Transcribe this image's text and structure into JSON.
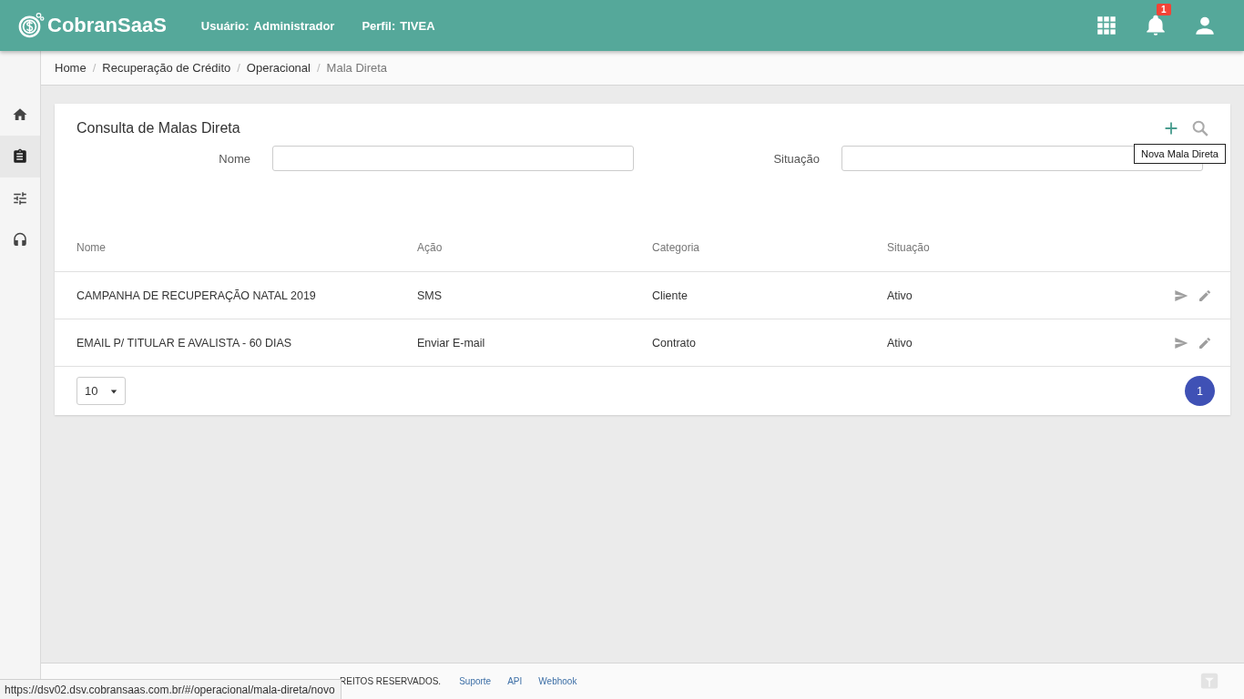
{
  "header": {
    "brand": "CobranSaaS",
    "user_label": "Usuário:",
    "user_value": "Administrador",
    "profile_label": "Perfil:",
    "profile_value": "TIVEA",
    "notification_count": "1"
  },
  "sidebar": {
    "items": [
      {
        "kind": "home",
        "selected": false
      },
      {
        "kind": "clipboard",
        "selected": true
      },
      {
        "kind": "sliders",
        "selected": false
      },
      {
        "kind": "headset",
        "selected": false
      }
    ]
  },
  "breadcrumb": {
    "separator": "/",
    "items": [
      "Home",
      "Recuperação de Crédito",
      "Operacional",
      "Mala Direta"
    ]
  },
  "card": {
    "title": "Consulta de Malas Direta",
    "tooltip": "Nova Mala Direta",
    "filters": [
      {
        "label": "Nome"
      },
      {
        "label": "Situação"
      }
    ],
    "columns": [
      "Nome",
      "Ação",
      "Categoria",
      "Situação"
    ],
    "rows": [
      [
        "CAMPANHA DE RECUPERAÇÃO NATAL 2019",
        "SMS",
        "Cliente",
        "Ativo"
      ],
      [
        "EMAIL P/ TITULAR E AVALISTA - 60 DIAS",
        "Enviar E-mail",
        "Contrato",
        "Ativo"
      ]
    ],
    "page_size": "10",
    "pages": [
      {
        "label": "1",
        "selected": true
      }
    ]
  },
  "footer": {
    "text": "REITOS RESERVADOS.",
    "links": [
      "Suporte",
      "API",
      "Webhook"
    ]
  },
  "status_url": "https://dsv02.dsv.cobransaas.com.br/#/operacional/mala-direta/novo"
}
